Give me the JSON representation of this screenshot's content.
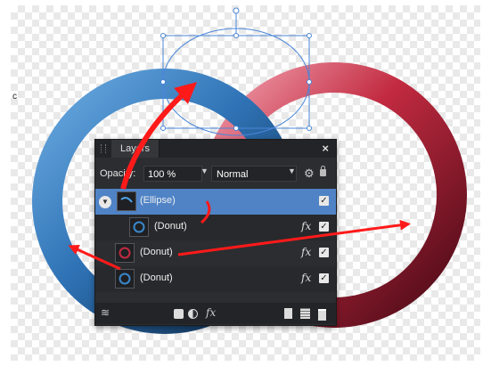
{
  "panel": {
    "tab_label": "Layers",
    "close_glyph": "×",
    "opacity_label": "Opacity:",
    "opacity_value": "100 %",
    "blend_mode": "Normal"
  },
  "layers": [
    {
      "name": "(Ellipse)",
      "selected": true,
      "visible": true,
      "expanded": true,
      "fx": false
    },
    {
      "name": "(Donut)",
      "selected": false,
      "visible": true,
      "child": true,
      "fx": true,
      "thumb_color": "#3a87c9"
    },
    {
      "name": "(Donut)",
      "selected": false,
      "visible": true,
      "fx": true,
      "thumb_color": "#c22a40"
    },
    {
      "name": "(Donut)",
      "selected": false,
      "visible": true,
      "fx": true,
      "thumb_color": "#3a87c9"
    }
  ],
  "bottom_icons": [
    "layers-icon",
    "mask-icon",
    "adjustment-icon",
    "fx-icon",
    "new-layer-icon",
    "group-icon",
    "trash-icon"
  ],
  "fx_label": "fx",
  "side_mark": "c",
  "colors": {
    "blue_ring": "#3a87c9",
    "red_ring": "#c22a40",
    "selection_row": "#4f83c6",
    "arrow": "#ff1a1a",
    "bounding_box": "#4a86d8"
  }
}
